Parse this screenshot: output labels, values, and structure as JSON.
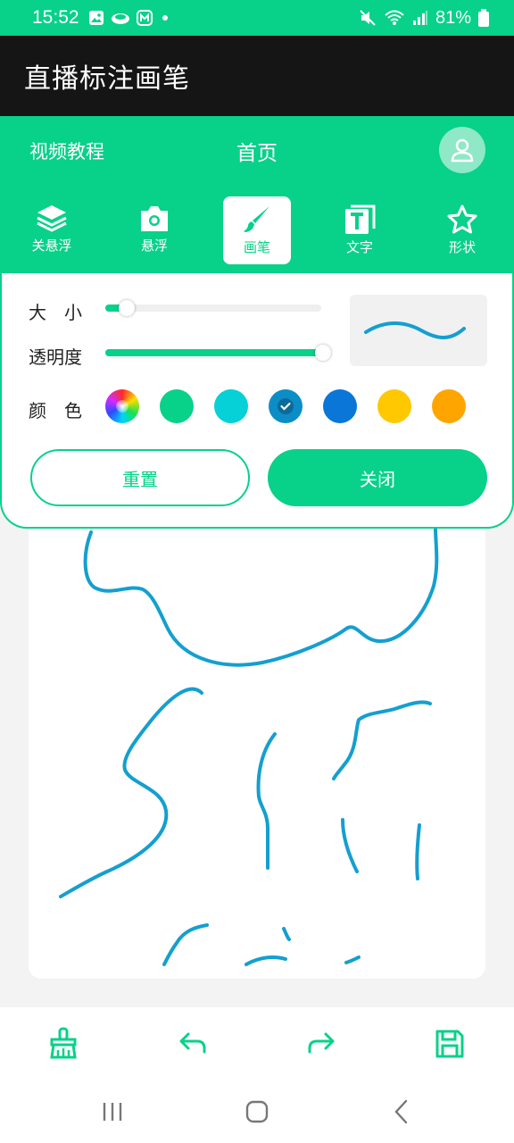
{
  "status_bar": {
    "time": "15:52",
    "battery": "81%",
    "left_icons": [
      "gallery-icon",
      "cloud-icon",
      "app-icon",
      "dot-icon"
    ],
    "right_icons": [
      "mute-icon",
      "wifi-icon",
      "signal-icon",
      "battery-icon"
    ]
  },
  "app": {
    "title": "直播标注画笔"
  },
  "header": {
    "left_link": "视频教程",
    "center_title": "首页",
    "avatar_icon": "user-icon"
  },
  "tools": [
    {
      "label": "关悬浮",
      "icon": "layers-icon",
      "active": false
    },
    {
      "label": "悬浮",
      "icon": "camera-icon",
      "active": false
    },
    {
      "label": "画笔",
      "icon": "brush-icon",
      "active": true
    },
    {
      "label": "文字",
      "icon": "text-icon",
      "active": false
    },
    {
      "label": "形状",
      "icon": "star-icon",
      "active": false
    }
  ],
  "settings": {
    "size_label": "大　小",
    "size_value": 0.1,
    "opacity_label": "透明度",
    "opacity_value": 1.0,
    "color_label": "颜　色",
    "colors": [
      "rainbow",
      "#08d18a",
      "#05d1d7",
      "#0c8dc6",
      "#0a76d8",
      "#ffc800",
      "#ffa500"
    ],
    "selected_color": "#0c8dc6",
    "reset_label": "重置",
    "close_label": "关闭"
  },
  "colors": {
    "accent": "#08d18a",
    "titlebar": "#151515",
    "stroke": "#149fd0"
  },
  "bottom_toolbar": {
    "icons": [
      "clear-brush-icon",
      "undo-icon",
      "redo-icon",
      "save-icon"
    ]
  },
  "system_nav": {
    "icons": [
      "recent-apps-icon",
      "home-icon",
      "back-icon"
    ]
  }
}
